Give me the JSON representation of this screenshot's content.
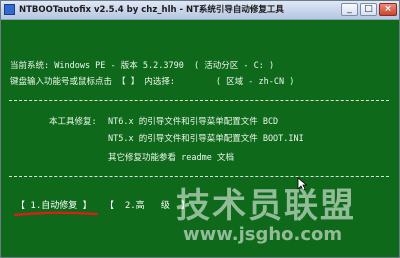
{
  "window": {
    "title": "NTBOOTautofix v2.5.4 by chz_hlh - NT系统引导自动修复工具",
    "minimize": "_",
    "maximize": "□",
    "close": "×"
  },
  "console": {
    "system_line": "当前系统: Windows PE - 版本 5.2.3790  ( 活动分区 - C: )",
    "prompt_line": "键盘输入功能号或鼠标点击 【 】 内选择:        ( 区域 - zh-CN )",
    "repair_heading": "本工具修复:",
    "repair_nt6": "NT6.x 的引导文件和引导菜单配置文件 BCD",
    "repair_nt5": "NT5.x 的引导文件和引导菜单配置文件 BOOT.INI",
    "repair_other": "其它修复功能参看 readme 文档"
  },
  "menu": {
    "auto_repair": "【 1.自动修复 】",
    "advanced": "【  2.高   级  】"
  },
  "watermark": {
    "logo": "技术员联盟",
    "url": "www.jsgho.com"
  },
  "colors": {
    "console_bg": "#0e6a1a",
    "console_text": "#eef6ee",
    "annotation_red": "#e01b1b"
  }
}
